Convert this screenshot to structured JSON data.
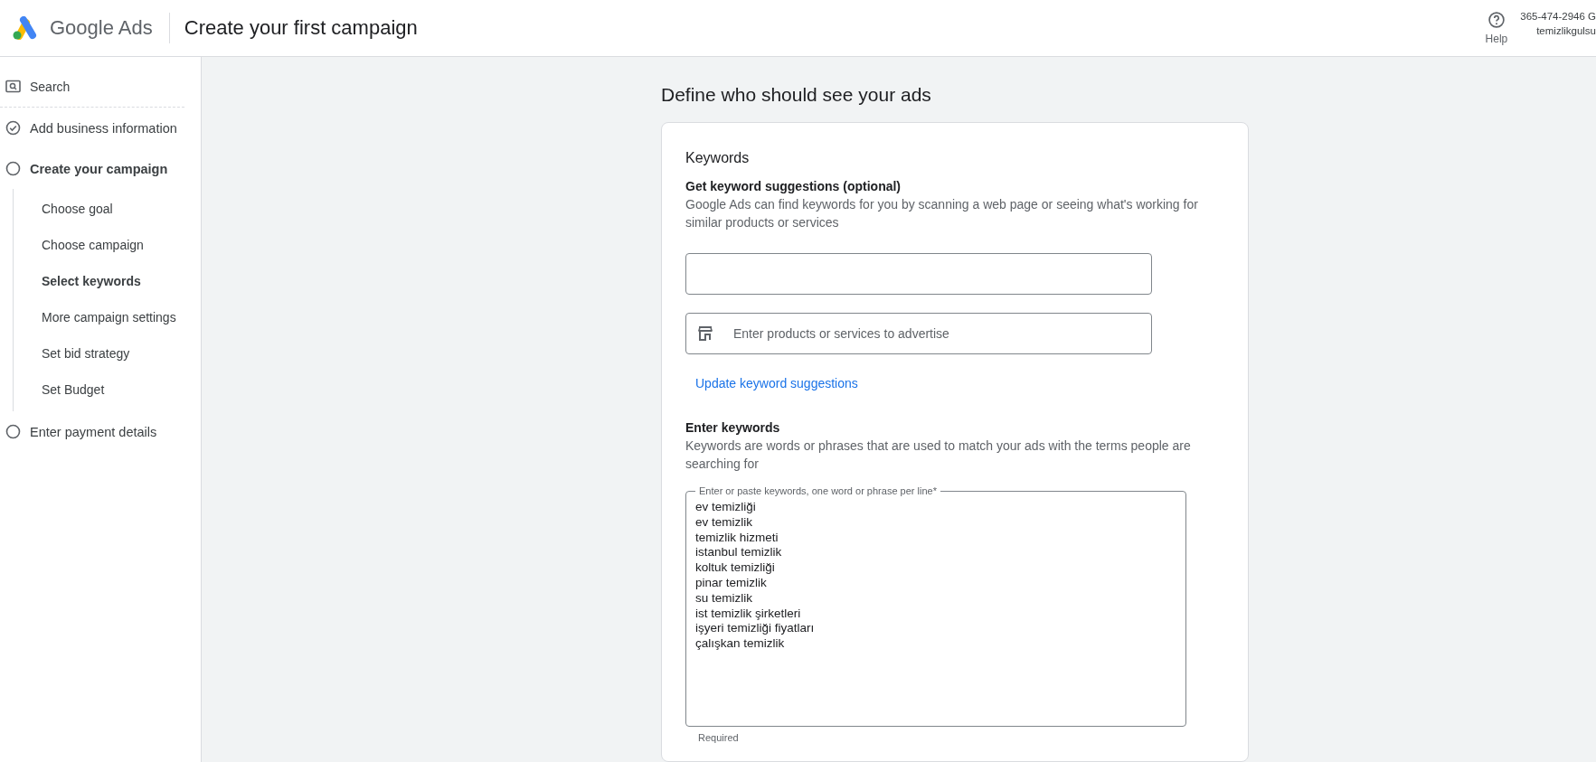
{
  "header": {
    "product": "Google Ads",
    "title": "Create your first campaign",
    "help": "Help",
    "account": {
      "number": "365-474-2946 G",
      "name": "temizlikgulsu"
    }
  },
  "sidebar": {
    "search": "Search",
    "steps": [
      {
        "label": "Add business information",
        "completed": true,
        "selected": false
      },
      {
        "label": "Create your campaign",
        "completed": false,
        "selected": true,
        "children": [
          {
            "label": "Choose goal",
            "selected": false
          },
          {
            "label": "Choose campaign",
            "selected": false
          },
          {
            "label": "Select keywords",
            "selected": true
          },
          {
            "label": "More campaign settings",
            "selected": false
          },
          {
            "label": "Set bid strategy",
            "selected": false
          },
          {
            "label": "Set Budget",
            "selected": false
          }
        ]
      },
      {
        "label": "Enter payment details",
        "completed": false,
        "selected": false
      }
    ]
  },
  "main": {
    "title": "Define who should see your ads",
    "card": {
      "title": "Keywords",
      "suggestions": {
        "heading": "Get keyword suggestions (optional)",
        "description": "Google Ads can find keywords for you by scanning a web page or seeing what's working for similar products or services",
        "products_placeholder": "Enter products or services to advertise",
        "update_link": "Update keyword suggestions"
      },
      "keywords": {
        "heading": "Enter keywords",
        "description": "Keywords are words or phrases that are used to match your ads with the terms people are searching for",
        "field_label": "Enter or paste keywords, one word or phrase per line*",
        "value": "ev temizliği\nev temizlik\ntemizlik hizmeti\nistanbul temizlik\nkoltuk temizliği\npinar temizlik\nsu temizlik\nist temizlik şirketleri\nişyeri temizliği fiyatları\nçalışkan temizlik",
        "hint": "Required"
      }
    }
  }
}
